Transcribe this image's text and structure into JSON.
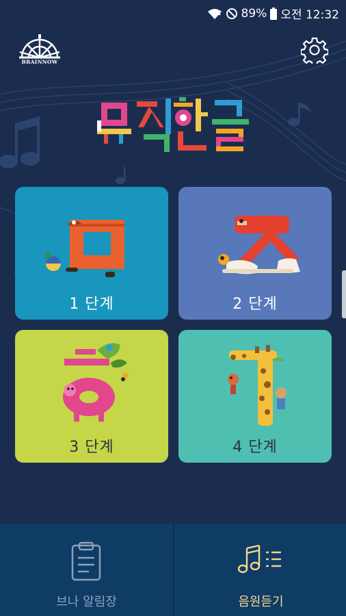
{
  "status_bar": {
    "battery": "89%",
    "time": "오전 12:32"
  },
  "header": {
    "logo_text": "BRAINNOW",
    "settings_icon": "gear-icon"
  },
  "title": {
    "text": "뮤직한글",
    "colors": [
      "#e2478e",
      "#f4a623",
      "#40b36a",
      "#2f9dd4",
      "#e54a3b",
      "#f2c94c"
    ]
  },
  "levels": [
    {
      "label": "1 단계",
      "letter": "ㅁ",
      "color": "#1896bd"
    },
    {
      "label": "2 단계",
      "letter": "ㅈ",
      "color": "#5878ba"
    },
    {
      "label": "3 단계",
      "letter": "ㅎ",
      "color": "#c5d748"
    },
    {
      "label": "4 단계",
      "letter": "ㄱ",
      "color": "#4fbfb2"
    }
  ],
  "bottom_nav": [
    {
      "label": "브나 알림장",
      "icon": "clipboard-icon",
      "active": false
    },
    {
      "label": "음원듣기",
      "icon": "music-list-icon",
      "active": true
    }
  ]
}
